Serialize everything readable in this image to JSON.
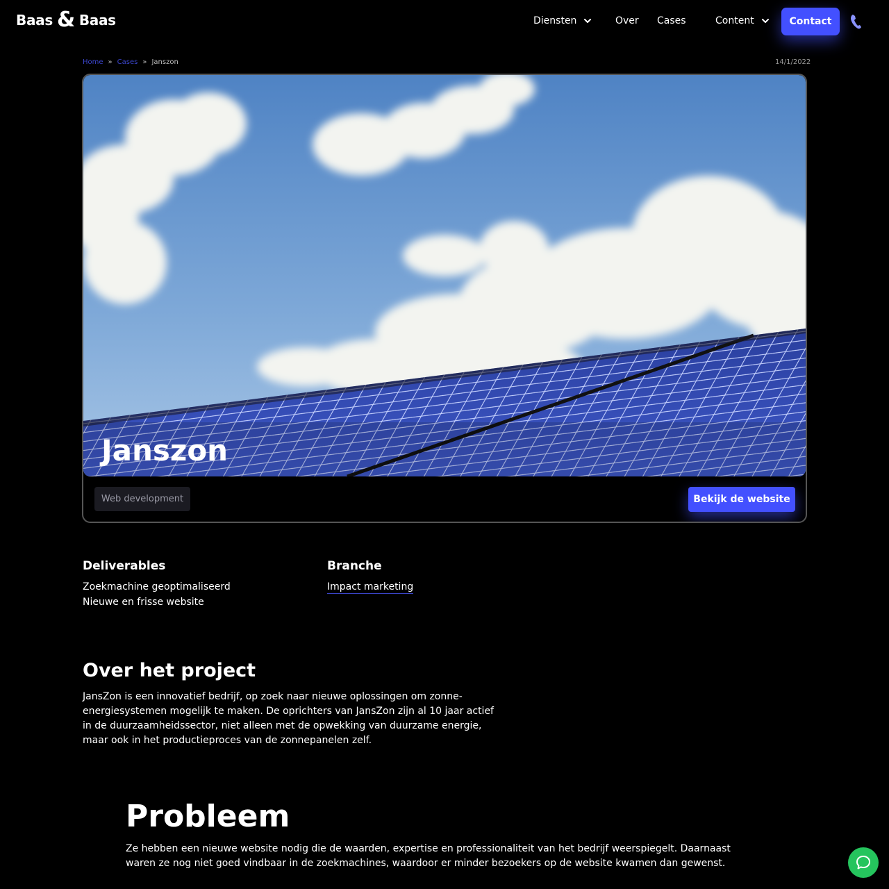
{
  "header": {
    "logo": {
      "left": "Baas",
      "amp": "&",
      "right": "Baas"
    },
    "nav": {
      "diensten": "Diensten",
      "over": "Over",
      "cases": "Cases",
      "content": "Content"
    },
    "contact_label": "Contact",
    "icons": {
      "dropdown": "chevron-down-icon",
      "phone": "phone-icon"
    }
  },
  "breadcrumb": {
    "home": "Home",
    "sep1": "»",
    "cases": "Cases",
    "sep2": "»",
    "current": "Janszon"
  },
  "date": "14/1/2022",
  "hero": {
    "title": "Janszon",
    "tag": "Web development",
    "cta": "Bekijk de website"
  },
  "deliverables": {
    "title": "Deliverables",
    "items": [
      "Zoekmachine geoptimaliseerd",
      "Nieuwe en frisse website"
    ]
  },
  "branche": {
    "title": "Branche",
    "value": "Impact marketing"
  },
  "project": {
    "title": "Over het project",
    "text": "JansZon is een innovatief bedrijf, op zoek naar nieuwe oplossingen om zonne-energiesystemen mogelijk te maken. De oprichters van JansZon zijn al 10 jaar actief in de duurzaamheidssector, niet alleen met de opwekking van duurzame energie, maar ook in het productieproces van de zonnepanelen zelf."
  },
  "probleem": {
    "title": "Probleem",
    "text": "Ze hebben een nieuwe website nodig die de waarden, expertise en professionaliteit van het bedrijf weerspiegelt. Daarnaast waren ze nog niet goed vindbaar in de zoekmachines, waardoor er minder bezoekers op de website kwamen dan gewenst."
  },
  "colors": {
    "accent": "#4350ff",
    "background": "#000000",
    "chat": "#25c45d",
    "link": "#3a44c8"
  }
}
